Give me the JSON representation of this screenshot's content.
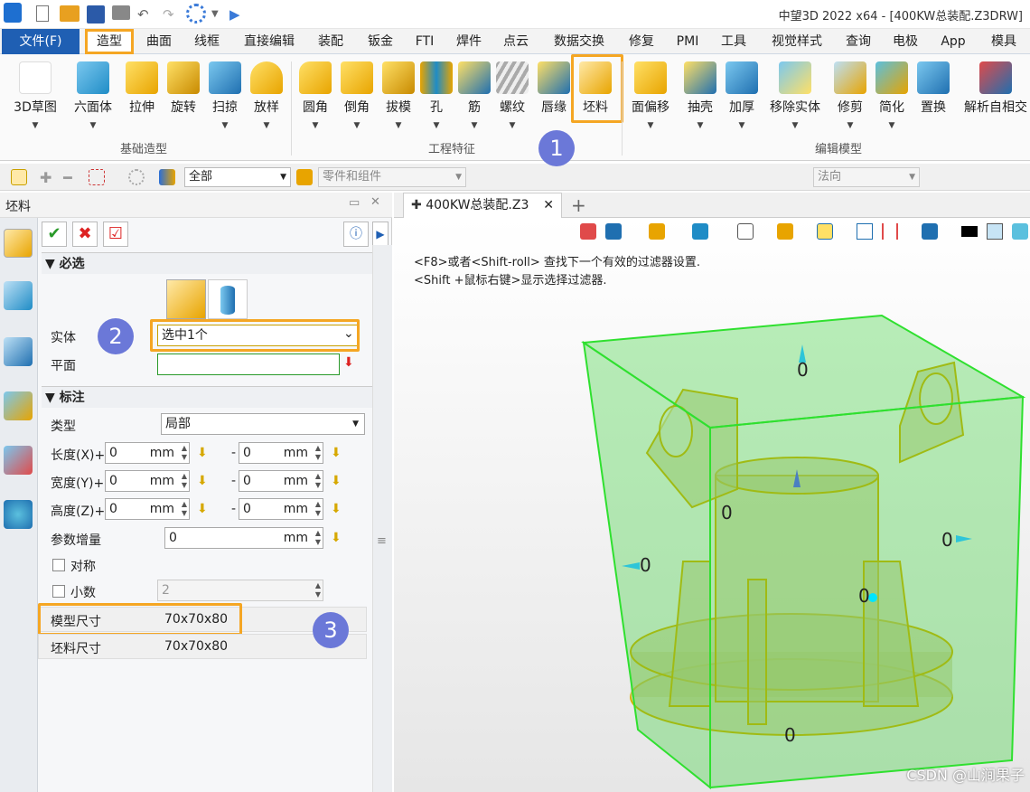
{
  "title_bar": {
    "title": "中望3D 2022 x64 - [400KW总装配.Z3DRW]"
  },
  "menu": [
    "文件(F)",
    "造型",
    "曲面",
    "线框",
    "直接编辑",
    "装配",
    "钣金",
    "FTI",
    "焊件",
    "点云",
    "数据交换",
    "修复",
    "PMI",
    "工具",
    "视觉样式",
    "查询",
    "电极",
    "App",
    "模具"
  ],
  "ribbon": {
    "groups": [
      "基础造型",
      "工程特征",
      "编辑模型"
    ],
    "basic": [
      "3D草图",
      "六面体",
      "拉伸",
      "旋转",
      "扫掠",
      "放样"
    ],
    "engineering": [
      "圆角",
      "倒角",
      "拔模",
      "孔",
      "筋",
      "螺纹",
      "唇缘",
      "坯料"
    ],
    "edit": [
      "面偏移",
      "抽壳",
      "加厚",
      "移除实体",
      "修剪",
      "简化",
      "置换",
      "解析自相交"
    ]
  },
  "toolbar": {
    "filter_value": "全部",
    "parts_placeholder": "零件和组件",
    "direction_placeholder": "法向"
  },
  "panel": {
    "title": "坯料",
    "required_section": "必选",
    "solid_label": "实体",
    "solid_value": "选中1个",
    "plane_label": "平面",
    "plane_value": "",
    "dim_section": "标注",
    "type_label": "类型",
    "type_value": "局部",
    "length_label": "长度(X)+",
    "width_label": "宽度(Y)+",
    "height_label": "高度(Z)+",
    "zero": "0",
    "unit": "mm",
    "dash": "-",
    "increment_label": "参数增量",
    "increment_value": "0",
    "symmetric_label": "对称",
    "decimal_label": "小数",
    "decimal_value": "2",
    "model_size_label": "模型尺寸",
    "model_size_value": "70x70x80",
    "blank_size_label": "坯料尺寸",
    "blank_size_value": "70x70x80"
  },
  "badges": [
    "1",
    "2",
    "3"
  ],
  "document": {
    "tab": "400KW总装配.Z3",
    "hint1": "<F8>或者<Shift-roll> 查找下一个有效的过滤器设置.",
    "hint2": "<Shift +鼠标右键>显示选择过滤器."
  },
  "dims": [
    "0",
    "0",
    "0",
    "0",
    "0",
    "0"
  ],
  "watermark": "CSDN @山涧果子",
  "colors": {
    "accent": "#f5a623",
    "file_menu": "#1f5fb3",
    "badge": "#6b78d8",
    "blank_box": "#39e639"
  }
}
